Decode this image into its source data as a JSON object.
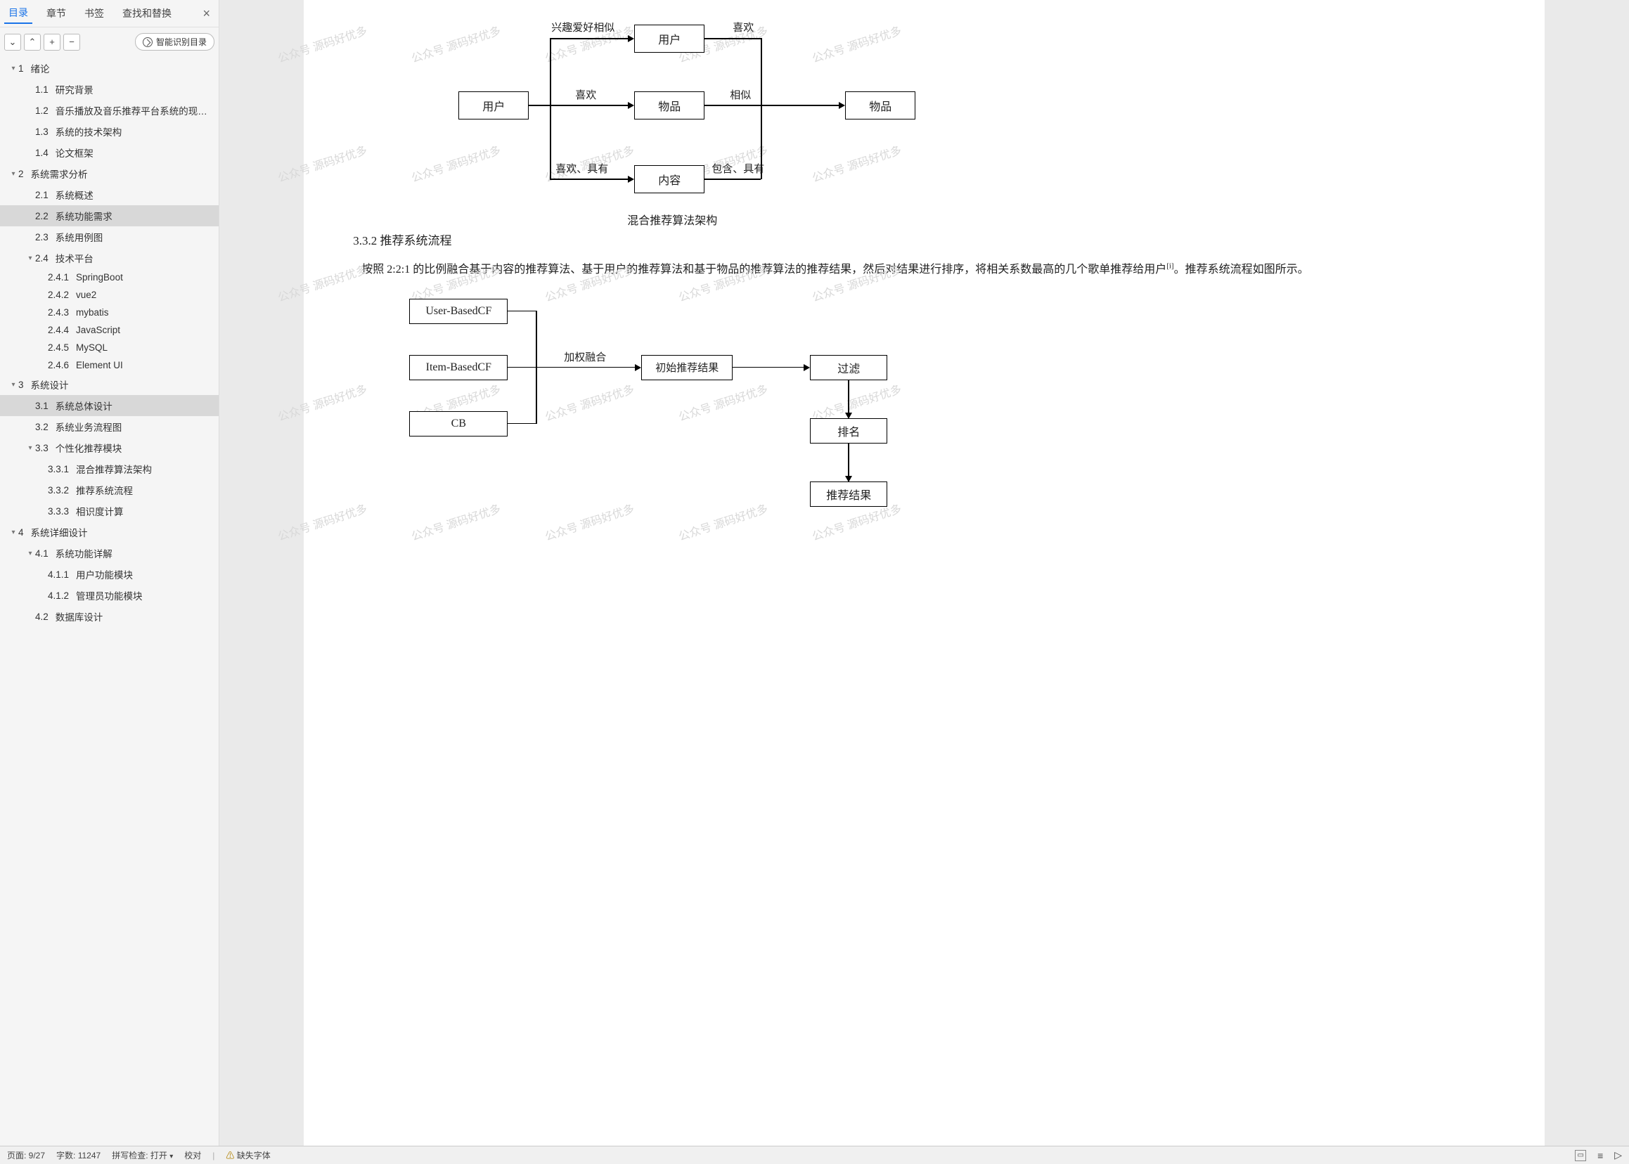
{
  "tabs": {
    "toc": "目录",
    "chapter": "章节",
    "bookmark": "书签",
    "find": "查找和替换"
  },
  "toolbar": {
    "smart": "智能识别目录"
  },
  "toc": [
    {
      "lvl": 1,
      "chev": "▾",
      "num": "1",
      "txt": "绪论"
    },
    {
      "lvl": 2,
      "num": "1.1",
      "txt": "研究背景"
    },
    {
      "lvl": 2,
      "num": "1.2",
      "txt": "音乐播放及音乐推荐平台系统的现…"
    },
    {
      "lvl": 2,
      "num": "1.3",
      "txt": "系统的技术架构"
    },
    {
      "lvl": 2,
      "num": "1.4",
      "txt": "论文框架"
    },
    {
      "lvl": 1,
      "chev": "▾",
      "num": "2",
      "txt": "系统需求分析"
    },
    {
      "lvl": 2,
      "num": "2.1",
      "txt": "系统概述"
    },
    {
      "lvl": 2,
      "num": "2.2",
      "txt": "系统功能需求",
      "sel": true
    },
    {
      "lvl": 2,
      "num": "2.3",
      "txt": "系统用例图"
    },
    {
      "lvl": 2,
      "chev": "▾",
      "num": "2.4",
      "txt": "技术平台"
    },
    {
      "lvl": 3,
      "num": "2.4.1",
      "txt": "SpringBoot"
    },
    {
      "lvl": 3,
      "num": "2.4.2",
      "txt": "vue2"
    },
    {
      "lvl": 3,
      "num": "2.4.3",
      "txt": "mybatis"
    },
    {
      "lvl": 3,
      "num": "2.4.4",
      "txt": "JavaScript"
    },
    {
      "lvl": 3,
      "num": "2.4.5",
      "txt": "MySQL"
    },
    {
      "lvl": 3,
      "num": "2.4.6",
      "txt": "Element UI"
    },
    {
      "lvl": 1,
      "chev": "▾",
      "num": "3",
      "txt": "系统设计"
    },
    {
      "lvl": 2,
      "num": "3.1",
      "txt": "系统总体设计",
      "sel": true
    },
    {
      "lvl": 2,
      "num": "3.2",
      "txt": "系统业务流程图"
    },
    {
      "lvl": 2,
      "chev": "▾",
      "num": "3.3",
      "txt": "个性化推荐模块"
    },
    {
      "lvl": 3,
      "num": "3.3.1",
      "txt": "混合推荐算法架构"
    },
    {
      "lvl": 3,
      "num": "3.3.2",
      "txt": "推荐系统流程"
    },
    {
      "lvl": 3,
      "num": "3.3.3",
      "txt": "相识度计算"
    },
    {
      "lvl": 1,
      "chev": "▾",
      "num": "4",
      "txt": "系统详细设计"
    },
    {
      "lvl": 2,
      "chev": "▾",
      "num": "4.1",
      "txt": "系统功能详解"
    },
    {
      "lvl": 3,
      "num": "4.1.1",
      "txt": "用户功能模块"
    },
    {
      "lvl": 3,
      "num": "4.1.2",
      "txt": "管理员功能模块"
    },
    {
      "lvl": 2,
      "num": "4.2",
      "txt": "数据库设计"
    }
  ],
  "watermark": "公众号 源码好优多",
  "diag1": {
    "caption": "混合推荐算法架构",
    "nodes": {
      "user_src": "用户",
      "user": "用户",
      "item": "物品",
      "content": "内容",
      "item2": "物品"
    },
    "edges": {
      "e1": "兴趣爱好相似",
      "e2": "喜欢",
      "e3": "喜欢",
      "e4": "相似",
      "e5": "喜欢、具有",
      "e6": "包含、具有"
    }
  },
  "doc": {
    "h3": "3.3.2 推荐系统流程",
    "p1": "按照 2:2:1 的比例融合基于内容的推荐算法、基于用户的推荐算法和基于物品的推荐算法的推荐结果，然后对结果进行排序，将相关系数最高的几个歌单推荐给用户",
    "p1b": "。推荐系统流程如图所示。",
    "cite": "[i]"
  },
  "diag2": {
    "nodes": {
      "ucf": "User-BasedCF",
      "icf": "Item-BasedCF",
      "cb": "CB",
      "init": "初始推荐结果",
      "filter": "过滤",
      "rank": "排名",
      "result": "推荐结果"
    },
    "edges": {
      "merge": "加权融合"
    }
  },
  "status": {
    "page": "页面: 9/27",
    "words": "字数: 11247",
    "spell": "拼写检查: 打开",
    "proof": "校对",
    "missing": "缺失字体"
  }
}
